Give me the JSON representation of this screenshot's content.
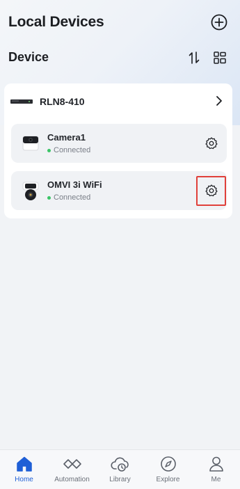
{
  "header": {
    "title": "Local Devices"
  },
  "section": {
    "title": "Device"
  },
  "group": {
    "name": "RLN8-410"
  },
  "devices": [
    {
      "name": "Camera1",
      "status": "Connected"
    },
    {
      "name": "OMVI 3i WiFi",
      "status": "Connected"
    }
  ],
  "tabs": [
    {
      "label": "Home",
      "icon": "home-icon",
      "active": true
    },
    {
      "label": "Automation",
      "icon": "automation-icon",
      "active": false
    },
    {
      "label": "Library",
      "icon": "cloud-clock-icon",
      "active": false
    },
    {
      "label": "Explore",
      "icon": "compass-icon",
      "active": false
    },
    {
      "label": "Me",
      "icon": "person-icon",
      "active": false
    }
  ],
  "colors": {
    "accent": "#1f5fd6",
    "status_ok": "#3bc467",
    "highlight": "#e0403a"
  }
}
